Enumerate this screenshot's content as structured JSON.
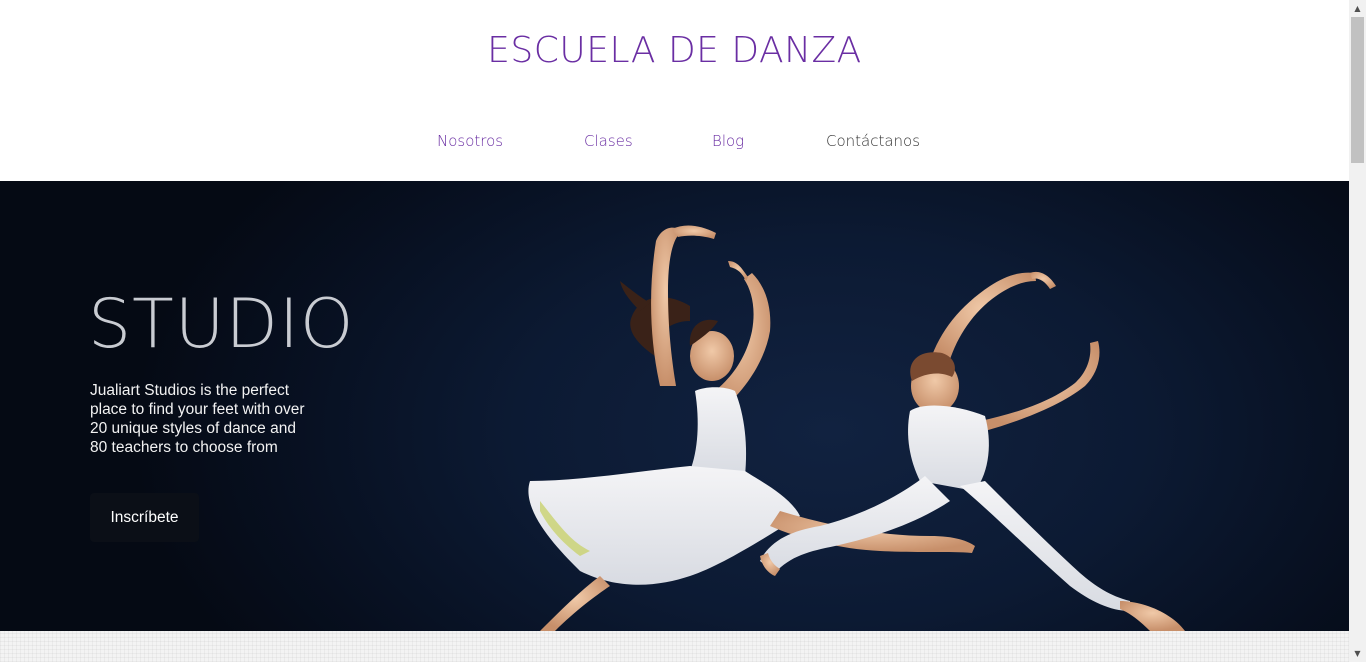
{
  "header": {
    "site_title": "ESCUELA DE DANZA"
  },
  "nav": {
    "items": [
      {
        "label": "Nosotros"
      },
      {
        "label": "Clases"
      },
      {
        "label": "Blog"
      },
      {
        "label": "Contáctanos"
      }
    ]
  },
  "hero": {
    "heading": "STUDIO",
    "text": "Jualiart Studios is the perfect place to find your feet with over 20 unique styles of dance and 80 teachers to choose from",
    "button_label": "Inscríbete",
    "image_icon": "dancers-photo"
  },
  "colors": {
    "accent": "#6a2ea3",
    "hero_background": "#0c1a33",
    "button_background": "#0b0f17"
  },
  "scrollbar": {
    "up_icon": "▲",
    "down_icon": "▼"
  }
}
